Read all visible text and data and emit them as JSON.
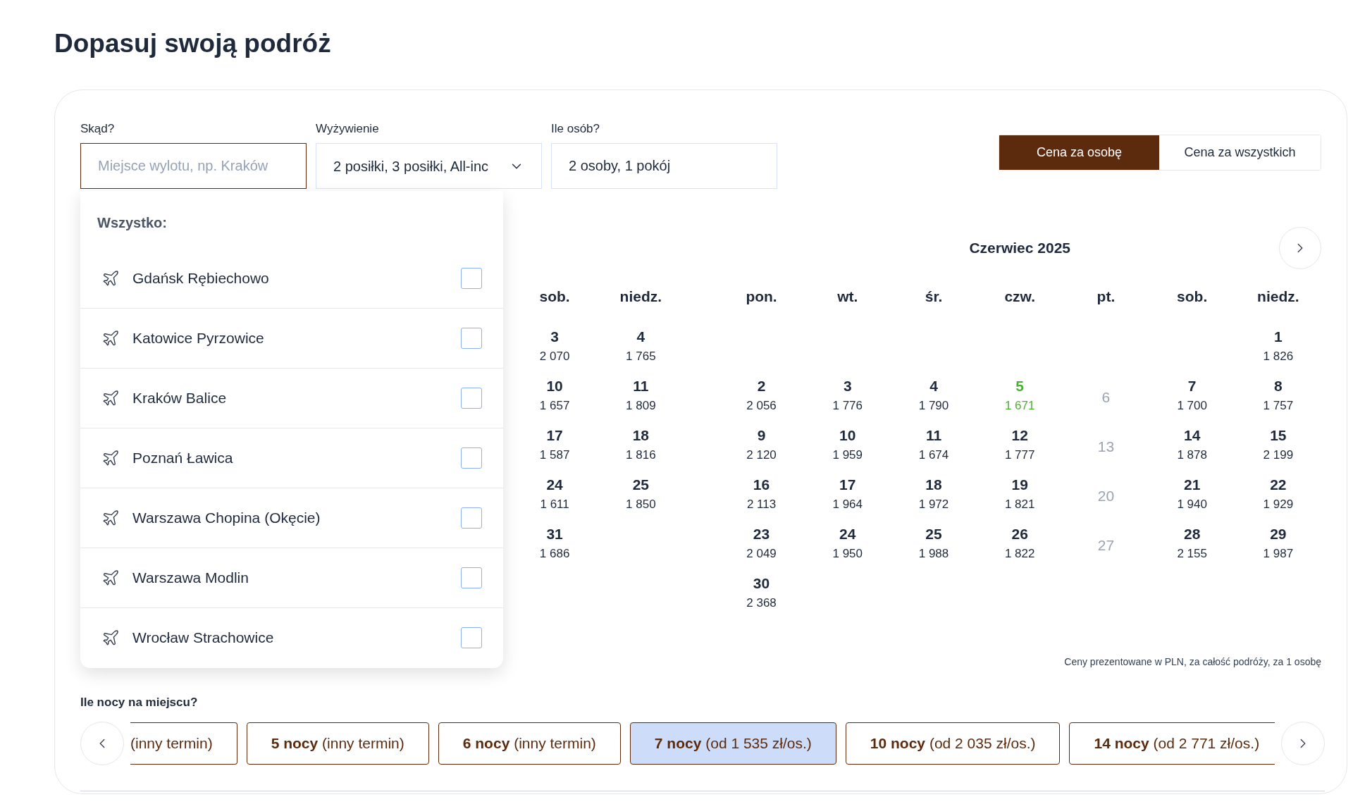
{
  "title": "Dopasuj swoją podróż",
  "fields": [
    {
      "label": "Skąd?",
      "placeholder": "Miejsce wylotu, np. Kraków",
      "kind": "text",
      "focused": true
    },
    {
      "label": "Wyżywienie",
      "value": "2 posiłki, 3 posiłki, All-inc",
      "kind": "select",
      "focused": false
    },
    {
      "label": "Ile osób?",
      "value": "2 osoby, 1 pokój",
      "kind": "text",
      "focused": false
    }
  ],
  "price_toggle": [
    {
      "label": "Cena za osobę",
      "selected": true
    },
    {
      "label": "Cena za wszystkich",
      "selected": false
    }
  ],
  "airport_dropdown": {
    "heading": "Wszystko:",
    "items": [
      {
        "name": "Gdańsk Rębiechowo",
        "checked": false
      },
      {
        "name": "Katowice Pyrzowice",
        "checked": false
      },
      {
        "name": "Kraków Balice",
        "checked": false
      },
      {
        "name": "Poznań Ławica",
        "checked": false
      },
      {
        "name": "Warszawa Chopina (Okęcie)",
        "checked": false
      },
      {
        "name": "Warszawa Modlin",
        "checked": false
      },
      {
        "name": "Wrocław Strachowice",
        "checked": false
      }
    ]
  },
  "calendar": {
    "months": [
      {
        "weekdays": [
          "sob.",
          "niedz."
        ],
        "weeks": [
          [
            {
              "day": "3",
              "price": "2 070",
              "kind": "available"
            },
            {
              "day": "4",
              "price": "1 765",
              "kind": "available"
            }
          ],
          [
            {
              "day": "10",
              "price": "1 657",
              "kind": "available"
            },
            {
              "day": "11",
              "price": "1 809",
              "kind": "available"
            }
          ],
          [
            {
              "day": "17",
              "price": "1 587",
              "kind": "available"
            },
            {
              "day": "18",
              "price": "1 816",
              "kind": "available"
            }
          ],
          [
            {
              "day": "24",
              "price": "1 611",
              "kind": "available"
            },
            {
              "day": "25",
              "price": "1 850",
              "kind": "available"
            }
          ],
          [
            {
              "day": "31",
              "price": "1 686",
              "kind": "available"
            },
            {
              "kind": "empty"
            }
          ]
        ]
      },
      {
        "title": "Czerwiec 2025",
        "weekdays": [
          "pon.",
          "wt.",
          "śr.",
          "czw.",
          "pt.",
          "sob.",
          "niedz."
        ],
        "weeks": [
          [
            {
              "kind": "empty"
            },
            {
              "kind": "empty"
            },
            {
              "kind": "empty"
            },
            {
              "kind": "empty"
            },
            {
              "kind": "empty"
            },
            {
              "kind": "empty"
            },
            {
              "day": "1",
              "price": "1 826",
              "kind": "available"
            }
          ],
          [
            {
              "day": "2",
              "price": "2 056",
              "kind": "available"
            },
            {
              "day": "3",
              "price": "1 776",
              "kind": "available"
            },
            {
              "day": "4",
              "price": "1 790",
              "kind": "available"
            },
            {
              "day": "5",
              "price": "1 671",
              "kind": "best"
            },
            {
              "day": "6",
              "kind": "unavailable"
            },
            {
              "day": "7",
              "price": "1 700",
              "kind": "available"
            },
            {
              "day": "8",
              "price": "1 757",
              "kind": "available"
            }
          ],
          [
            {
              "day": "9",
              "price": "2 120",
              "kind": "available"
            },
            {
              "day": "10",
              "price": "1 959",
              "kind": "available"
            },
            {
              "day": "11",
              "price": "1 674",
              "kind": "available"
            },
            {
              "day": "12",
              "price": "1 777",
              "kind": "available"
            },
            {
              "day": "13",
              "kind": "unavailable"
            },
            {
              "day": "14",
              "price": "1 878",
              "kind": "available"
            },
            {
              "day": "15",
              "price": "2 199",
              "kind": "available"
            }
          ],
          [
            {
              "day": "16",
              "price": "2 113",
              "kind": "available"
            },
            {
              "day": "17",
              "price": "1 964",
              "kind": "available"
            },
            {
              "day": "18",
              "price": "1 972",
              "kind": "available"
            },
            {
              "day": "19",
              "price": "1 821",
              "kind": "available"
            },
            {
              "day": "20",
              "kind": "unavailable"
            },
            {
              "day": "21",
              "price": "1 940",
              "kind": "available"
            },
            {
              "day": "22",
              "price": "1 929",
              "kind": "available"
            }
          ],
          [
            {
              "day": "23",
              "price": "2 049",
              "kind": "available"
            },
            {
              "day": "24",
              "price": "1 950",
              "kind": "available"
            },
            {
              "day": "25",
              "price": "1 988",
              "kind": "available"
            },
            {
              "day": "26",
              "price": "1 822",
              "kind": "available"
            },
            {
              "day": "27",
              "kind": "unavailable"
            },
            {
              "day": "28",
              "price": "2 155",
              "kind": "available"
            },
            {
              "day": "29",
              "price": "1 987",
              "kind": "available"
            }
          ],
          [
            {
              "day": "30",
              "price": "2 368",
              "kind": "available"
            },
            {
              "kind": "empty"
            },
            {
              "kind": "empty"
            },
            {
              "kind": "empty"
            },
            {
              "kind": "empty"
            },
            {
              "kind": "empty"
            },
            {
              "kind": "empty"
            }
          ]
        ]
      }
    ],
    "note": "Ceny prezentowane w PLN, za całość podróży, za 1 osobę"
  },
  "nights": {
    "label": "Ile nocy na miejscu?",
    "options": [
      {
        "detail": "(inny termin)",
        "selected": false
      },
      {
        "nights": "5 nocy",
        "detail": "(inny termin)",
        "selected": false
      },
      {
        "nights": "6 nocy",
        "detail": "(inny termin)",
        "selected": false
      },
      {
        "nights": "7 nocy",
        "detail": "(od 1 535 zł/os.)",
        "selected": true
      },
      {
        "nights": "10 nocy",
        "detail": "(od 2 035 zł/os.)",
        "selected": false
      },
      {
        "nights": "14 nocy",
        "detail": "(od 2 771 zł/os.)",
        "selected": false
      }
    ]
  }
}
